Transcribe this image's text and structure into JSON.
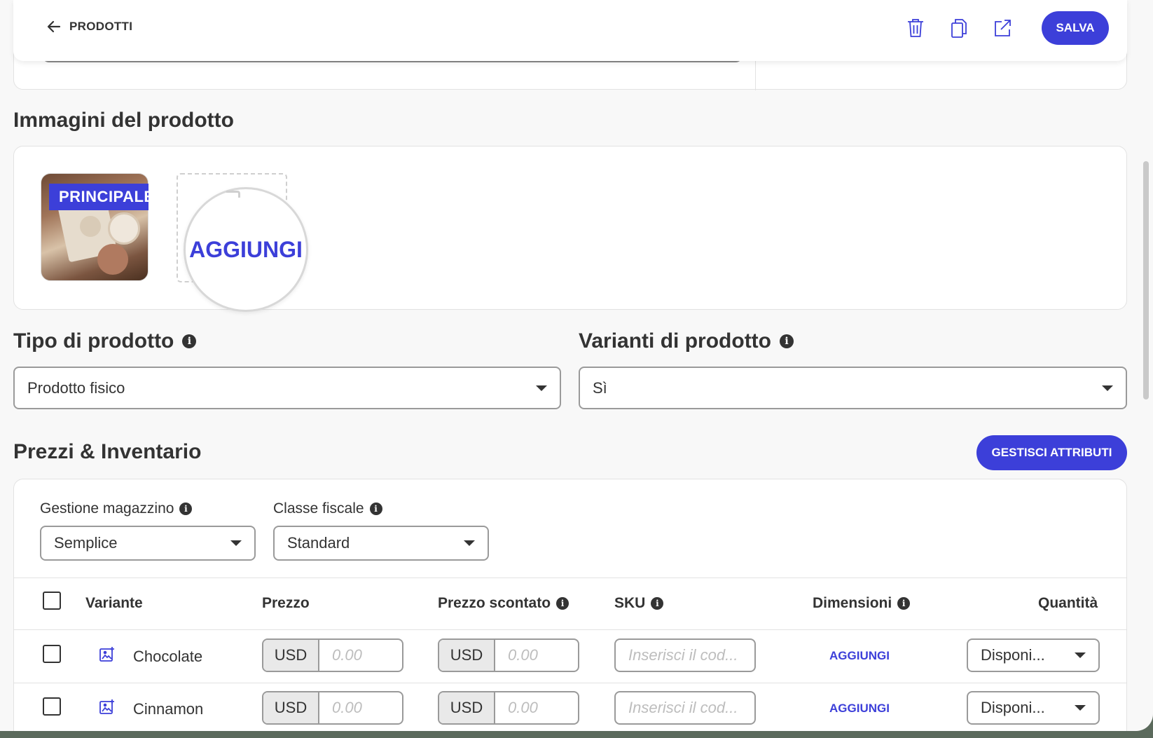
{
  "header": {
    "back_label": "PRODOTTI",
    "save_label": "SALVA"
  },
  "images_section": {
    "title": "Immagini del prodotto",
    "main_badge": "PRINCIPALE",
    "add_label": "AGGIUNGI"
  },
  "product_type": {
    "title": "Tipo di prodotto",
    "value": "Prodotto fisico"
  },
  "product_variants": {
    "title": "Varianti di prodotto",
    "value": "Sì"
  },
  "pricing": {
    "title": "Prezzi & Inventario",
    "manage_attributes_label": "GESTISCI ATTRIBUTI",
    "stock_management": {
      "label": "Gestione magazzino",
      "value": "Semplice"
    },
    "tax_class": {
      "label": "Classe fiscale",
      "value": "Standard"
    },
    "table": {
      "headers": {
        "variant": "Variante",
        "price": "Prezzo",
        "discounted_price": "Prezzo scontato",
        "sku": "SKU",
        "dimensions": "Dimensioni",
        "quantity": "Quantità"
      },
      "rows": [
        {
          "name": "Chocolate",
          "currency": "USD",
          "price_placeholder": "0.00",
          "discount_currency": "USD",
          "discount_placeholder": "0.00",
          "sku_placeholder": "Inserisci il cod...",
          "dimensions_action": "AGGIUNGI",
          "quantity": "Disponi..."
        },
        {
          "name": "Cinnamon",
          "currency": "USD",
          "price_placeholder": "0.00",
          "discount_currency": "USD",
          "discount_placeholder": "0.00",
          "sku_placeholder": "Inserisci il cod...",
          "dimensions_action": "AGGIUNGI",
          "quantity": "Disponi..."
        }
      ]
    }
  },
  "colors": {
    "accent": "#3c3fd9",
    "background": "#f8f8f8"
  }
}
